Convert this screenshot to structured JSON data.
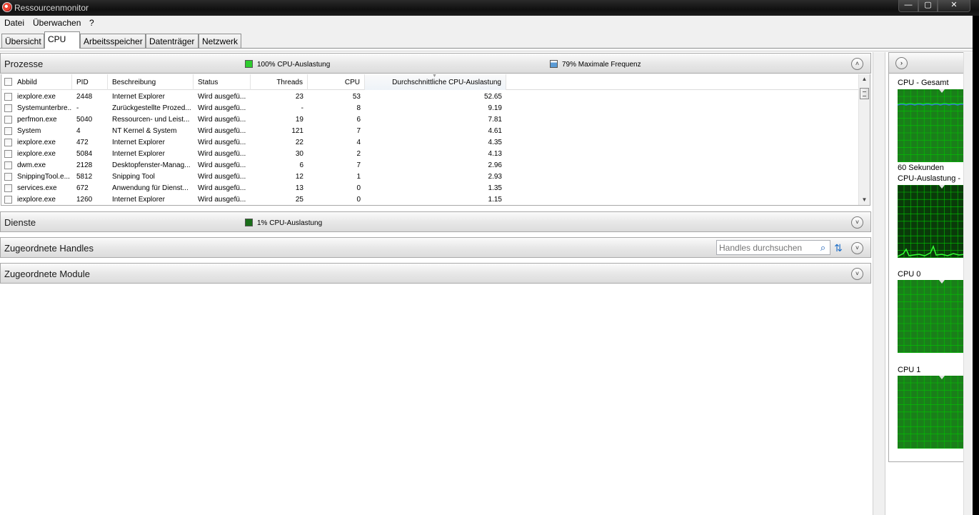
{
  "window": {
    "title": "Ressourcenmonitor",
    "minimize_glyph": "—",
    "maximize_glyph": "▢",
    "close_glyph": "✕"
  },
  "menu": [
    "Datei",
    "Überwachen",
    "?"
  ],
  "tabs": [
    "Übersicht",
    "CPU",
    "Arbeitsspeicher",
    "Datenträger",
    "Netzwerk"
  ],
  "active_tab": "CPU",
  "icons": {
    "app": "resource-monitor-icon",
    "chevron_up": "˄",
    "chevron_down": "˅",
    "chevron_right": "›",
    "search": "⌕",
    "refresh": "⇅",
    "scroll_up": "▲",
    "scroll_down": "▼"
  },
  "colors": {
    "cpu_usage": "#2ecc2e",
    "max_frequency": "#5b9bd5",
    "service_usage": "#1a6e1a",
    "graph_bg": "#1a7f1a",
    "graph_grid": "#00c800",
    "graph_line": "#3a6ed8"
  },
  "processes": {
    "title": "Prozesse",
    "cpu_usage_label": "100% CPU-Auslastung",
    "max_freq_label": "79% Maximale Frequenz",
    "columns": [
      "Abbild",
      "PID",
      "Beschreibung",
      "Status",
      "Threads",
      "CPU",
      "Durchschnittliche CPU-Auslastung"
    ],
    "rows": [
      {
        "image": "iexplore.exe",
        "pid": "2448",
        "desc": "Internet Explorer",
        "status": "Wird ausgefü...",
        "threads": "23",
        "cpu": "53",
        "avg": "52.65"
      },
      {
        "image": "Systemunterbre...",
        "pid": "-",
        "desc": "Zurückgestellte Prozed...",
        "status": "Wird ausgefü...",
        "threads": "-",
        "cpu": "8",
        "avg": "9.19"
      },
      {
        "image": "perfmon.exe",
        "pid": "5040",
        "desc": "Ressourcen- und Leist...",
        "status": "Wird ausgefü...",
        "threads": "19",
        "cpu": "6",
        "avg": "7.81"
      },
      {
        "image": "System",
        "pid": "4",
        "desc": "NT Kernel & System",
        "status": "Wird ausgefü...",
        "threads": "121",
        "cpu": "7",
        "avg": "4.61"
      },
      {
        "image": "iexplore.exe",
        "pid": "472",
        "desc": "Internet Explorer",
        "status": "Wird ausgefü...",
        "threads": "22",
        "cpu": "4",
        "avg": "4.35"
      },
      {
        "image": "iexplore.exe",
        "pid": "5084",
        "desc": "Internet Explorer",
        "status": "Wird ausgefü...",
        "threads": "30",
        "cpu": "2",
        "avg": "4.13"
      },
      {
        "image": "dwm.exe",
        "pid": "2128",
        "desc": "Desktopfenster-Manag...",
        "status": "Wird ausgefü...",
        "threads": "6",
        "cpu": "7",
        "avg": "2.96"
      },
      {
        "image": "SnippingTool.e...",
        "pid": "5812",
        "desc": "Snipping Tool",
        "status": "Wird ausgefü...",
        "threads": "12",
        "cpu": "1",
        "avg": "2.93"
      },
      {
        "image": "services.exe",
        "pid": "672",
        "desc": "Anwendung für Dienst...",
        "status": "Wird ausgefü...",
        "threads": "13",
        "cpu": "0",
        "avg": "1.35"
      },
      {
        "image": "iexplore.exe",
        "pid": "1260",
        "desc": "Internet Explorer",
        "status": "Wird ausgefü...",
        "threads": "25",
        "cpu": "0",
        "avg": "1.15"
      }
    ]
  },
  "services": {
    "title": "Dienste",
    "cpu_usage_label": "1% CPU-Auslastung"
  },
  "handles": {
    "title": "Zugeordnete Handles",
    "search_placeholder": "Handles durchsuchen"
  },
  "modules": {
    "title": "Zugeordnete Module"
  },
  "graphs": {
    "cpu_total_label": "CPU - Gesamt",
    "seconds_label": "60 Sekunden",
    "service_label": "CPU-Auslastung -",
    "cpu0_label": "CPU 0",
    "cpu1_label": "CPU 1"
  }
}
